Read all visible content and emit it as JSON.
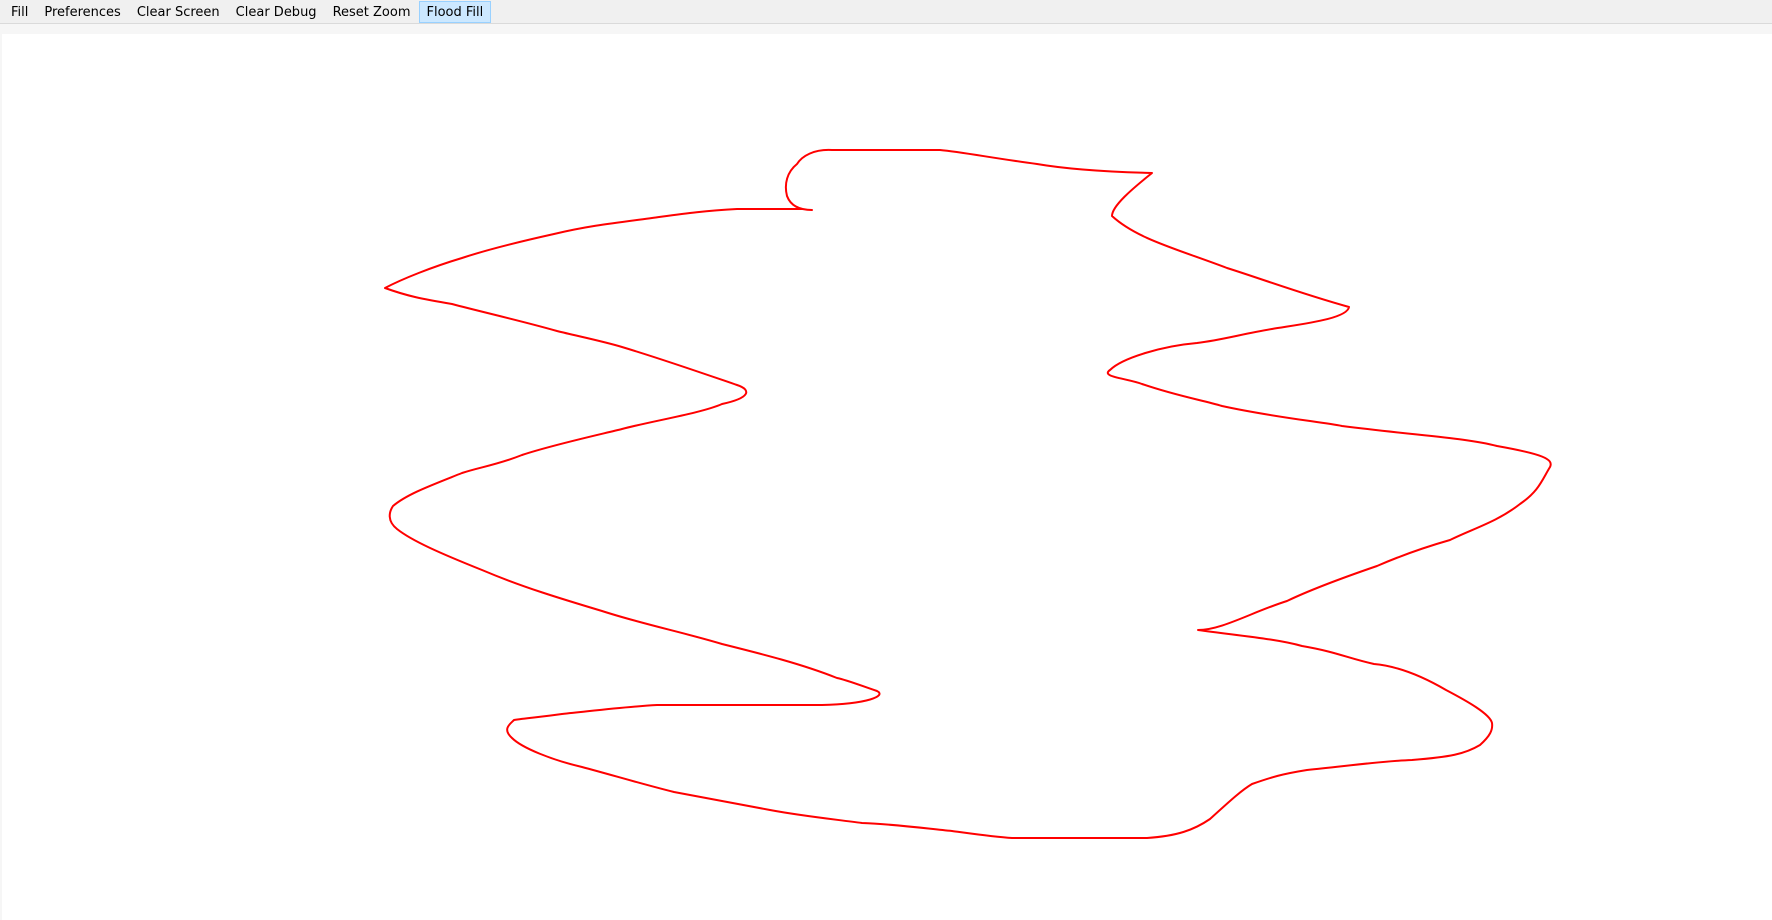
{
  "menubar": {
    "items": [
      {
        "label": "Fill",
        "active": false
      },
      {
        "label": "Preferences",
        "active": false
      },
      {
        "label": "Clear Screen",
        "active": false
      },
      {
        "label": "Clear Debug",
        "active": false
      },
      {
        "label": "Reset Zoom",
        "active": false
      },
      {
        "label": "Flood Fill",
        "active": true
      }
    ]
  },
  "canvas": {
    "background": "#ffffff",
    "stroke_color": "#ff0000"
  }
}
